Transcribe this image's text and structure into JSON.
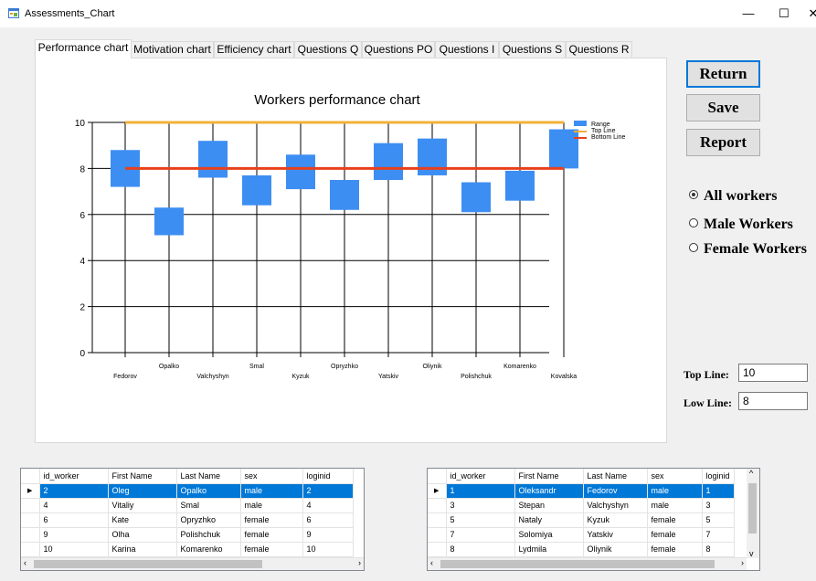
{
  "window": {
    "title": "Assessments_Chart",
    "minimize": "—",
    "maximize": "☐",
    "close": "✕"
  },
  "tabs": [
    "Performance chart",
    "Motivation chart",
    "Efficiency chart",
    "Questions Q",
    "Questions PO",
    "Questions I",
    "Questions S",
    "Questions R"
  ],
  "chart_data": {
    "type": "range_bar",
    "title": "Workers performance chart",
    "categories": [
      "Fedorov",
      "Opalko",
      "Valchyshyn",
      "Smal",
      "Kyzuk",
      "Opryzhko",
      "Yatskiv",
      "Oliynik",
      "Polishchuk",
      "Komarenko",
      "Kovalska"
    ],
    "ranges": [
      [
        7.2,
        8.8
      ],
      [
        5.1,
        6.3
      ],
      [
        7.6,
        9.2
      ],
      [
        6.4,
        7.7
      ],
      [
        7.1,
        8.6
      ],
      [
        6.2,
        7.5
      ],
      [
        7.5,
        9.1
      ],
      [
        7.7,
        9.3
      ],
      [
        6.1,
        7.4
      ],
      [
        6.6,
        7.9
      ],
      [
        8.0,
        9.7
      ]
    ],
    "top_line": 10,
    "bottom_line": 8,
    "ylim": [
      0,
      10
    ],
    "yticks": [
      "0",
      "2",
      "4",
      "6",
      "8",
      "10"
    ],
    "legend": [
      "Range",
      "Top Line",
      "Bottom Line"
    ],
    "legend_position": "top-right",
    "colors": {
      "range": "#3d8ef2",
      "top_line": "#f2b13a",
      "bottom_line": "#e8401c"
    },
    "grid": true
  },
  "buttons": {
    "return": "Return",
    "save": "Save",
    "report": "Report"
  },
  "radios": [
    {
      "label": "All workers",
      "checked": true
    },
    {
      "label": "Male Workers",
      "checked": false
    },
    {
      "label": "Female Workers",
      "checked": false
    }
  ],
  "lines": {
    "top_label": "Top Line:",
    "top_value": "10",
    "low_label": "Low Line:",
    "low_value": "8"
  },
  "grid_left": {
    "columns": [
      "id_worker",
      "First Name",
      "Last Name",
      "sex",
      "loginid"
    ],
    "rows": [
      [
        "2",
        "Oleg",
        "Opalko",
        "male",
        "2"
      ],
      [
        "4",
        "Vitaliy",
        "Smal",
        "male",
        "4"
      ],
      [
        "6",
        "Kate",
        "Opryzhko",
        "female",
        "6"
      ],
      [
        "9",
        "Olha",
        "Polishchuk",
        "female",
        "9"
      ],
      [
        "10",
        "Karina",
        "Komarenko",
        "female",
        "10"
      ]
    ]
  },
  "grid_right": {
    "columns": [
      "id_worker",
      "First Name",
      "Last Name",
      "sex",
      "loginid"
    ],
    "rows": [
      [
        "1",
        "Oleksandr",
        "Fedorov",
        "male",
        "1"
      ],
      [
        "3",
        "Stepan",
        "Valchyshyn",
        "male",
        "3"
      ],
      [
        "5",
        "Nataly",
        "Kyzuk",
        "female",
        "5"
      ],
      [
        "7",
        "Solomiya",
        "Yatskiv",
        "female",
        "7"
      ],
      [
        "8",
        "Lydmila",
        "Oliynik",
        "female",
        "8"
      ]
    ]
  }
}
